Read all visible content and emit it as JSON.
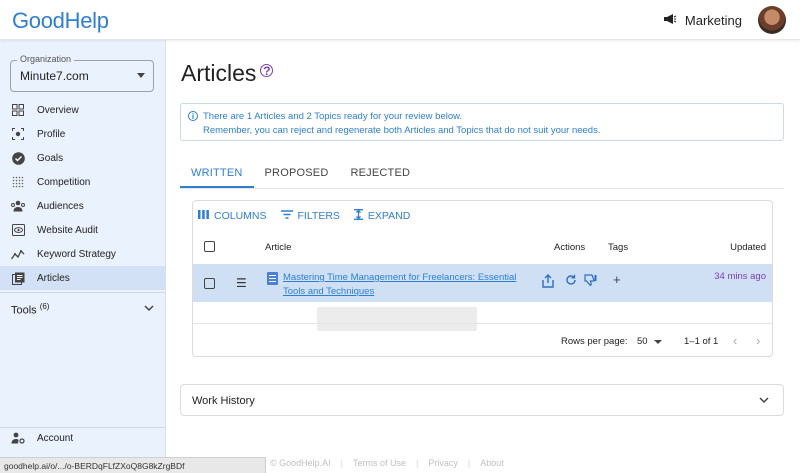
{
  "app": {
    "logo": "GoodHelp",
    "workspace": "Marketing"
  },
  "sidebar": {
    "org_label": "Organization",
    "org_value": "Minute7.com",
    "items": [
      {
        "label": "Overview",
        "icon": "grid-icon"
      },
      {
        "label": "Profile",
        "icon": "profile-scan-icon"
      },
      {
        "label": "Goals",
        "icon": "check-circle-icon"
      },
      {
        "label": "Competition",
        "icon": "dotted-grid-icon"
      },
      {
        "label": "Audiences",
        "icon": "audience-icon"
      },
      {
        "label": "Website Audit",
        "icon": "eye-box-icon"
      },
      {
        "label": "Keyword Strategy",
        "icon": "chart-trend-icon"
      },
      {
        "label": "Articles",
        "icon": "articles-icon",
        "active": true
      }
    ],
    "tools_label": "Tools",
    "tools_count": "(6)",
    "account_label": "Account"
  },
  "main": {
    "title": "Articles",
    "info_line1": "There are 1 Articles and 2 Topics ready for your review below.",
    "info_line2": "Remember, you can reject and regenerate both Articles and Topics that do not suit your needs.",
    "tabs": [
      {
        "label": "WRITTEN",
        "active": true
      },
      {
        "label": "PROPOSED"
      },
      {
        "label": "REJECTED"
      }
    ],
    "toolbar": {
      "columns": "COLUMNS",
      "filters": "FILTERS",
      "expand": "EXPAND"
    },
    "table": {
      "headers": {
        "article": "Article",
        "actions": "Actions",
        "tags": "Tags",
        "updated": "Updated"
      },
      "rows": [
        {
          "title": "Mastering Time Management for Freelancers: Essential Tools and Techniques",
          "updated": "34 mins ago",
          "add_tag": "+"
        }
      ]
    },
    "pager": {
      "rows_per_page_label": "Rows per page:",
      "rows_per_page_value": "50",
      "range": "1–1 of 1"
    },
    "work_history": "Work History"
  },
  "footer": {
    "copyright": "© GoodHelp.AI",
    "terms": "Terms of Use",
    "privacy": "Privacy",
    "about": "About"
  },
  "statusbar": {
    "url": "goodhelp.ai/o/.../o-BERDqFLfZXoQ8G8kZrgBDf"
  }
}
